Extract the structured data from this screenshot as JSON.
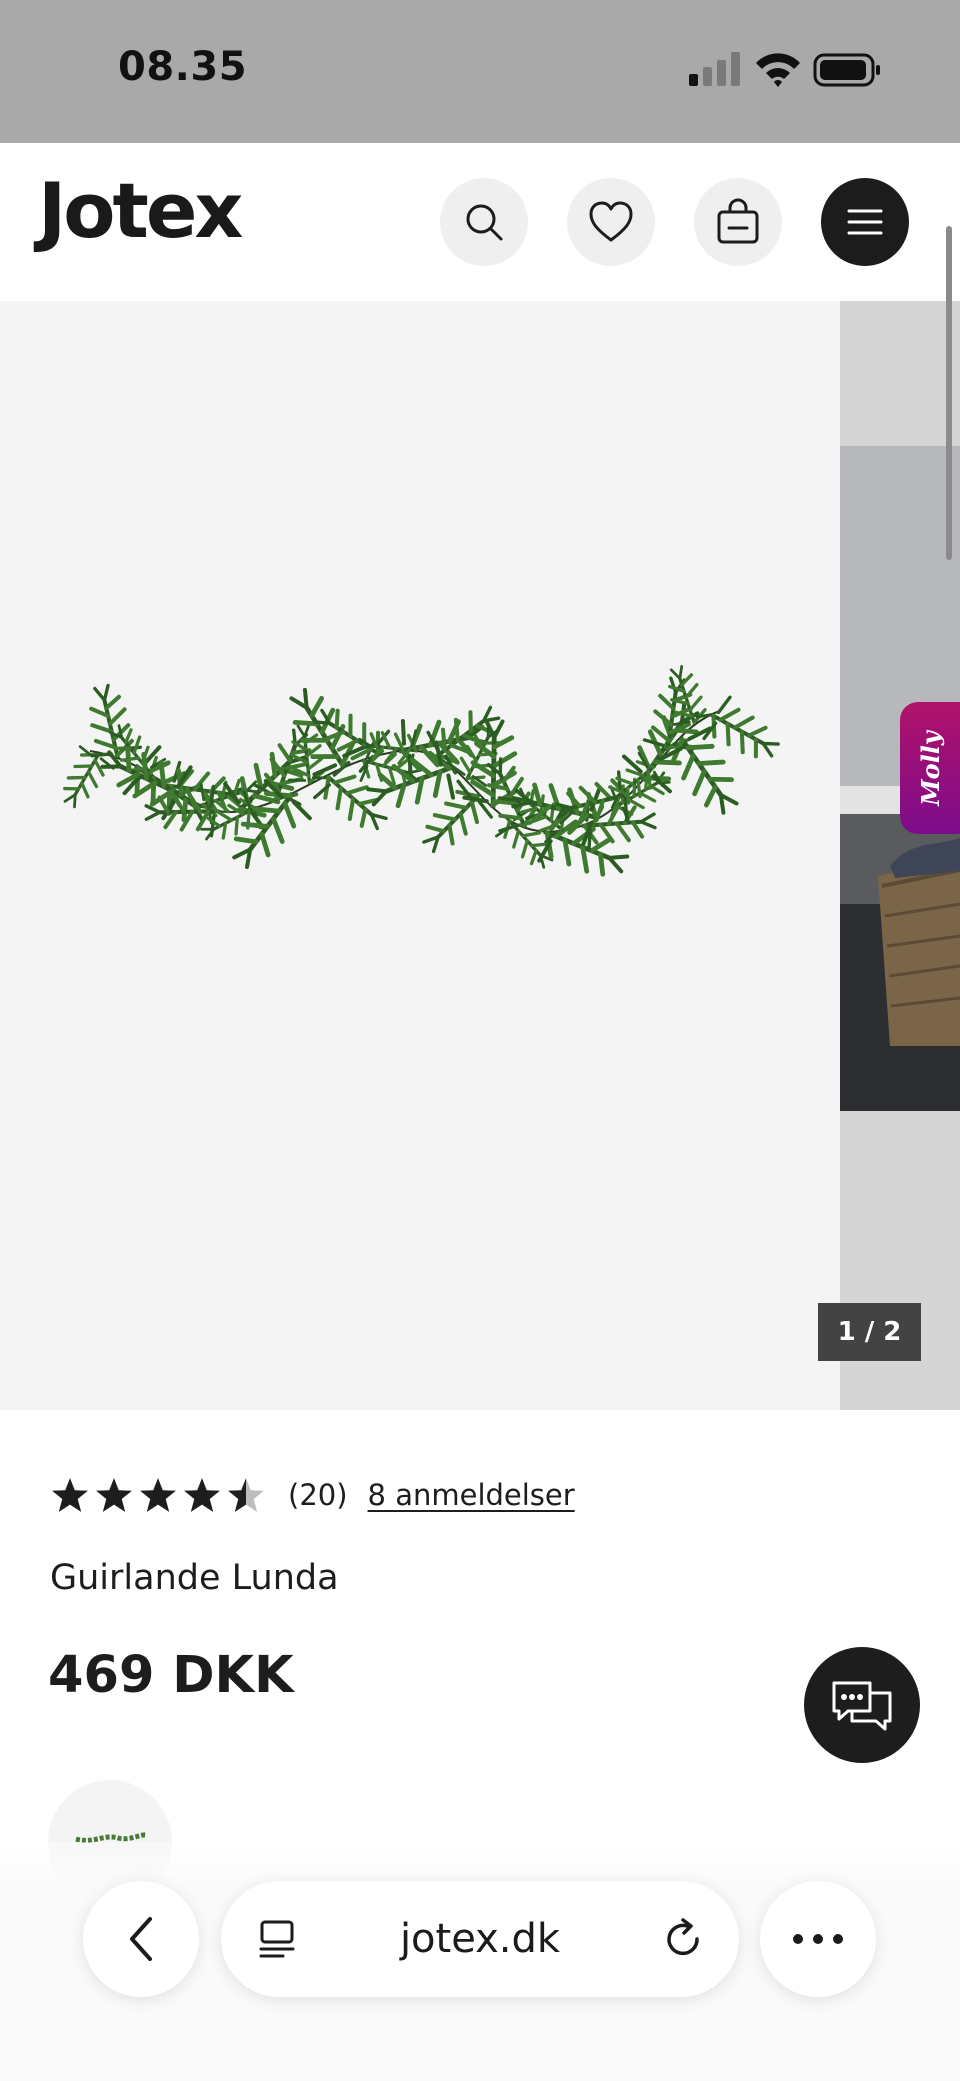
{
  "status_bar": {
    "time": "08.35"
  },
  "header": {
    "logo": "Jotex"
  },
  "gallery": {
    "counter": "1 / 2",
    "assistant_tab": "Molly"
  },
  "product": {
    "rating_value": 4.5,
    "rating_count": "(20)",
    "reviews_link": "8 anmeldelser",
    "title": "Guirlande Lunda",
    "price": "469 DKK"
  },
  "browser": {
    "url": "jotex.dk"
  },
  "colors": {
    "header_icon_bg": "#efefef",
    "menu_bg": "#1c1c1c",
    "molly_gradient_start": "#b0126a",
    "molly_gradient_end": "#7d0c8b"
  }
}
